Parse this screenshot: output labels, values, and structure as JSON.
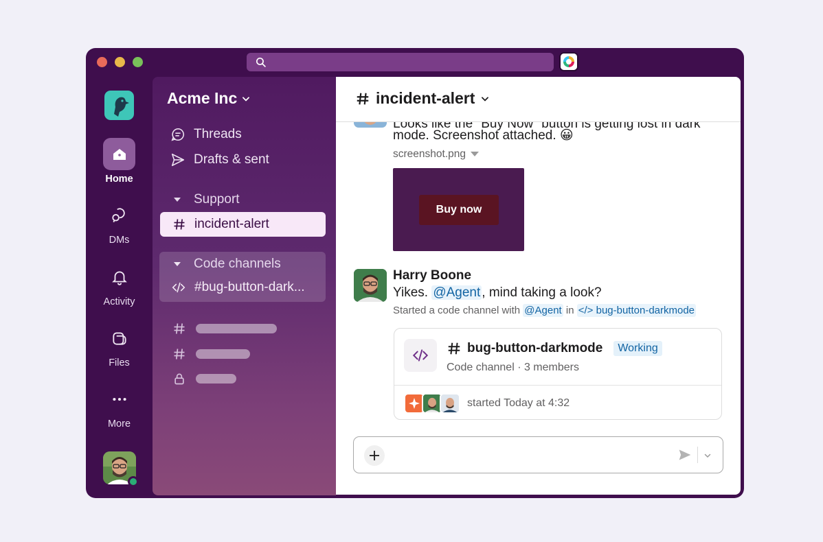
{
  "workspace": {
    "name": "Acme Inc"
  },
  "rail": {
    "items": [
      {
        "label": "Home",
        "icon": "home-icon"
      },
      {
        "label": "DMs",
        "icon": "dms-icon"
      },
      {
        "label": "Activity",
        "icon": "bell-icon"
      },
      {
        "label": "Files",
        "icon": "files-icon"
      },
      {
        "label": "More",
        "icon": "more-icon"
      }
    ]
  },
  "sidebar": {
    "nav": [
      {
        "label": "Threads",
        "icon": "threads-icon"
      },
      {
        "label": "Drafts & sent",
        "icon": "send-icon"
      }
    ],
    "sections": [
      {
        "label": "Support",
        "channels": [
          {
            "label": "incident-alert",
            "active": true
          }
        ]
      },
      {
        "label": "Code channels",
        "channels": [
          {
            "label": "#bug-button-dark..."
          }
        ]
      }
    ]
  },
  "channel": {
    "name": "incident-alert"
  },
  "messages": {
    "first": {
      "line1": "Looks like the \"Buy Now\" button is getting lost in dark",
      "line2": "mode. Screenshot attached. 😀",
      "file_name": "screenshot.png",
      "preview_button": "Buy now"
    },
    "second": {
      "author": "Harry Boone",
      "text_pre": "Yikes. ",
      "mention": "@Agent",
      "text_post": ", mind taking a look?",
      "sys_pre": "Started a code channel with ",
      "sys_mention": "@Agent",
      "sys_mid": " in ",
      "sys_channel": "</> bug-button-darkmode"
    }
  },
  "card": {
    "title": "bug-button-darkmode",
    "badge": "Working",
    "subtitle": "Code channel · 3 members",
    "footer": "started Today at 4:32"
  },
  "colors": {
    "window": "#3f0e4d",
    "active_channel_bg": "#f8e8f8",
    "mention": "#1264a3",
    "preview_bg": "#4a1b50",
    "preview_button": "#5a1422",
    "presence": "#2bac76"
  }
}
